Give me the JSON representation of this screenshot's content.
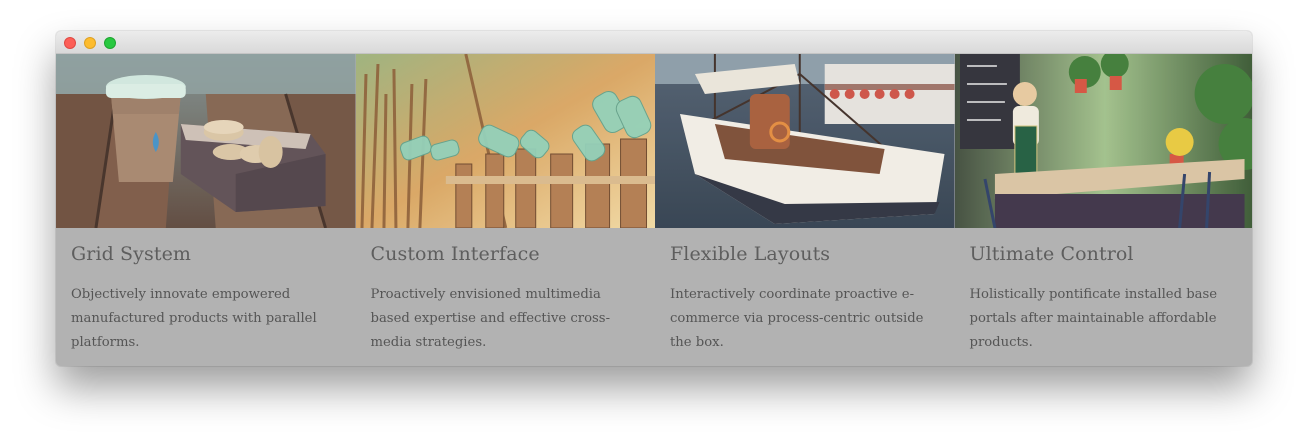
{
  "window": {
    "controls": [
      "close",
      "minimize",
      "maximize"
    ]
  },
  "features": [
    {
      "photo": "coffee-cup-photo",
      "title": "Grid System",
      "text": "Objectively innovate empowered manufactured products with parallel platforms."
    },
    {
      "photo": "glass-bottles-fence-photo",
      "title": "Custom Interface",
      "text": "Proactively envisioned multimedia based expertise and effective cross-media strategies."
    },
    {
      "photo": "sailing-boat-photo",
      "title": "Flexible Layouts",
      "text": "Interactively coordinate proactive e-commerce via process-centric outside the box."
    },
    {
      "photo": "cafe-terrace-photo",
      "title": "Ultimate Control",
      "text": "Holistically pontificate installed base portals after maintainable affordable products."
    }
  ],
  "colors": {
    "card_background": "#b2b2b2",
    "title_text": "#5e5e5e",
    "body_text": "#555555",
    "close_button": "#fc5f57",
    "minimize_button": "#fdbc2e",
    "maximize_button": "#28c840"
  }
}
